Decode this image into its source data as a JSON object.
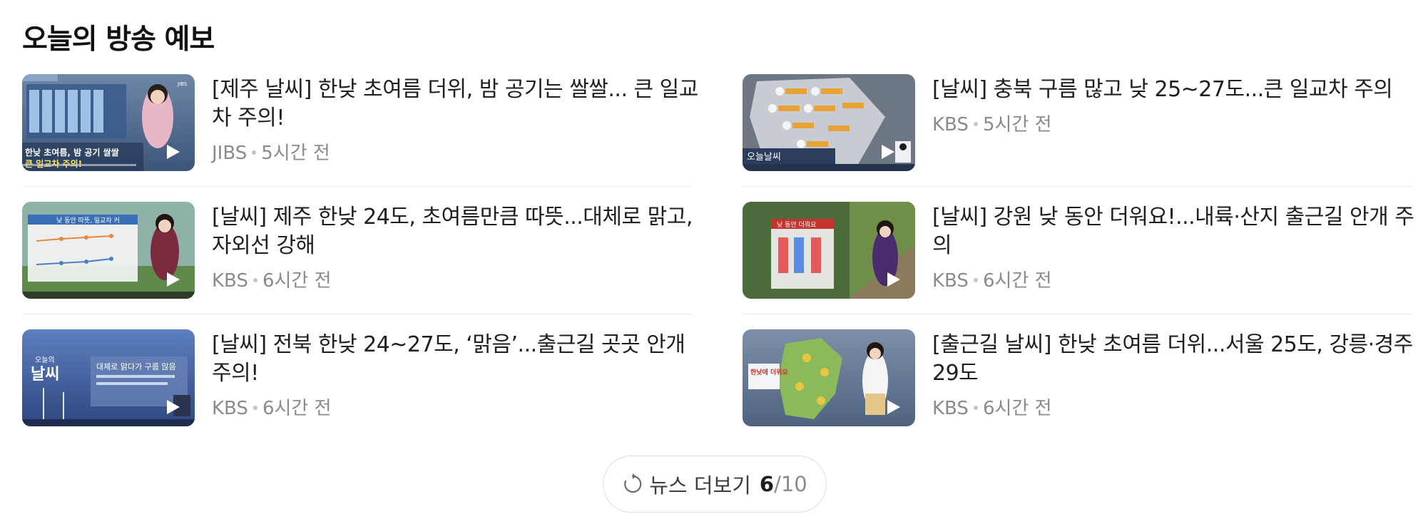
{
  "section": {
    "title": "오늘의 방송 예보"
  },
  "items": [
    {
      "title": "[제주 날씨] 한낮 초여름 더위, 밤 공기는 쌀쌀... 큰 일교차 주의!",
      "source": "JIBS",
      "time": "5시간 전",
      "thumb": {
        "caption": "한낮 초여름, 밤 공기 쌀쌀 큰 일교차 주의",
        "brand": "JIBS"
      }
    },
    {
      "title": "[날씨] 충북 구름 많고 낮 25~27도...큰 일교차 주의",
      "source": "KBS",
      "time": "5시간 전",
      "thumb": {
        "caption": "오늘날씨"
      }
    },
    {
      "title": "[날씨] 제주 한낮 24도, 초여름만큼 따뜻...대체로 맑고, 자외선 강해",
      "source": "KBS",
      "time": "6시간 전",
      "thumb": {
        "caption": "낮 동안 따뜻, 일교차 커"
      }
    },
    {
      "title": "[날씨] 강원 낮 동안 더워요!...내륙·산지 출근길 안개 주의",
      "source": "KBS",
      "time": "6시간 전",
      "thumb": {
        "caption": "낮 동안 더워요"
      }
    },
    {
      "title": "[날씨] 전북 한낮 24~27도, ‘맑음’...출근길 곳곳 안개 주의!",
      "source": "KBS",
      "time": "6시간 전",
      "thumb": {
        "caption": "대체로 맑다가 구름 많음",
        "logo": "오늘의 날씨"
      }
    },
    {
      "title": "[출근길 날씨] 한낮 초여름 더위...서울 25도, 강릉·경주 29도",
      "source": "KBS",
      "time": "6시간 전",
      "thumb": {
        "caption": "한낮에 더워요"
      }
    }
  ],
  "more_button": {
    "label": "뉴스 더보기",
    "count": "6",
    "total": "/10"
  }
}
